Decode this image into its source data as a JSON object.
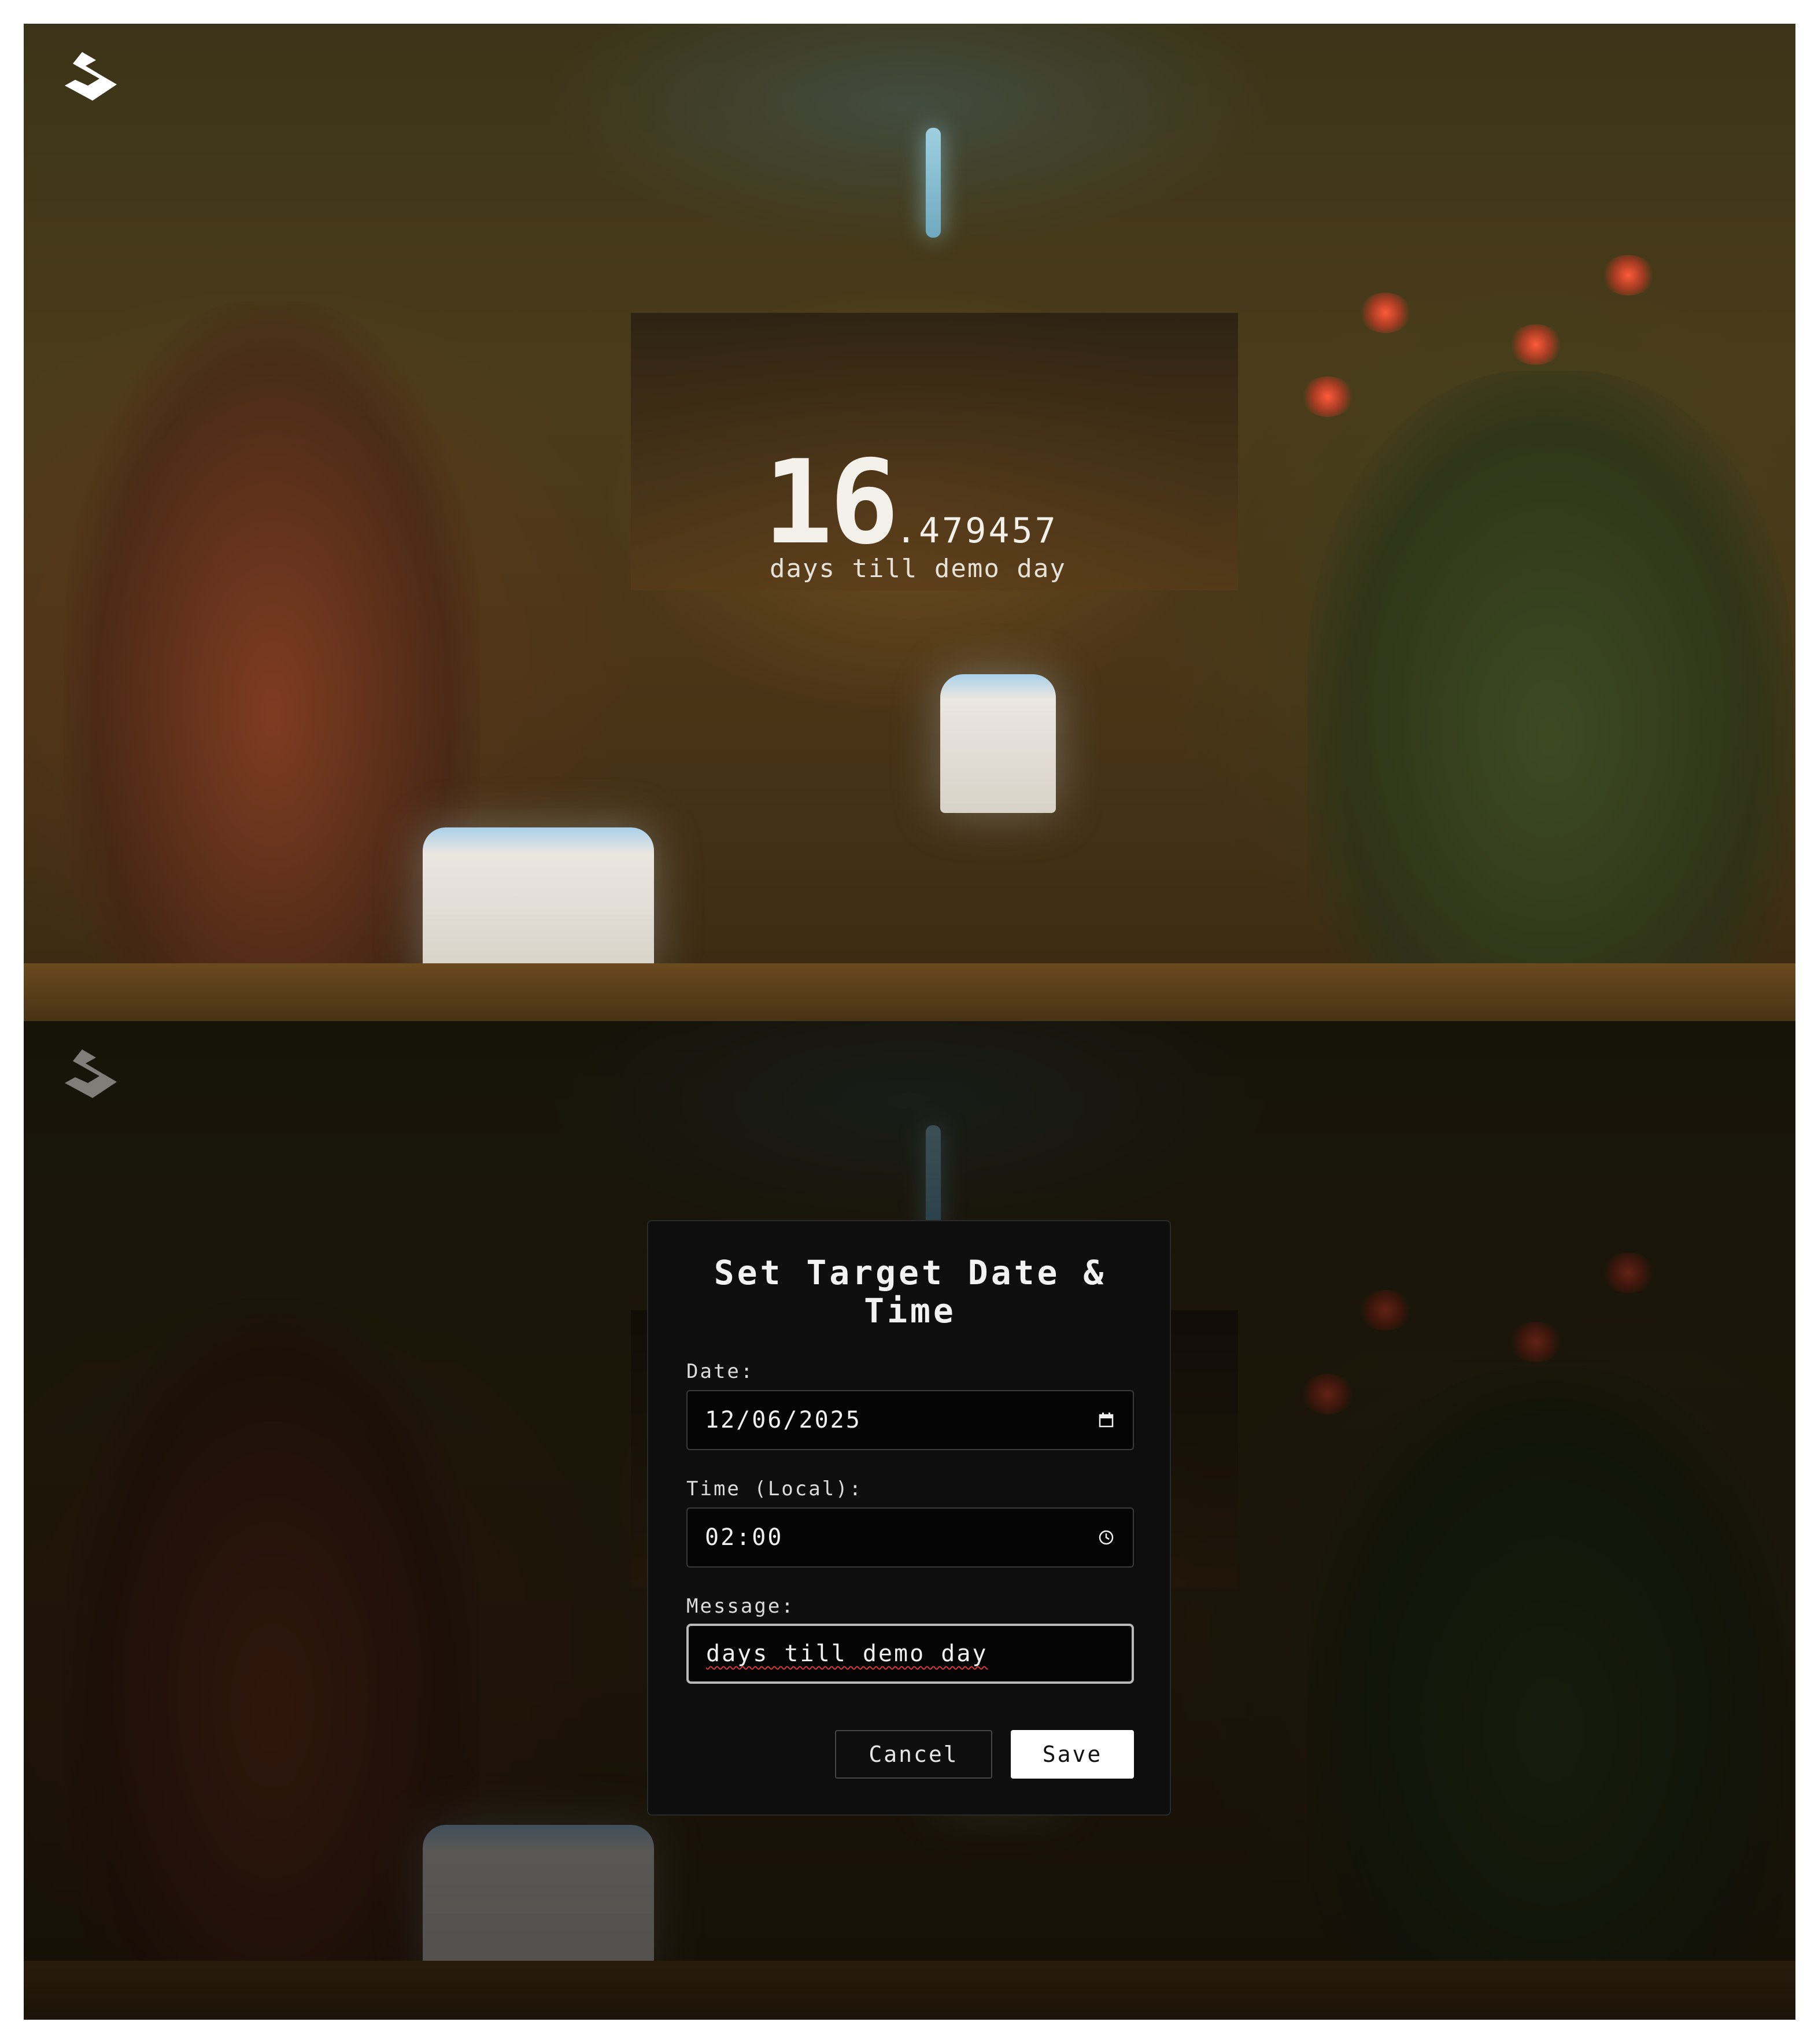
{
  "countdown": {
    "days_whole": "16",
    "days_fraction": ".479457",
    "message": "days till demo day"
  },
  "dialog": {
    "title": "Set Target Date & Time",
    "date_label": "Date:",
    "date_value": "12/06/2025",
    "time_label": "Time (Local):",
    "time_value": "02:00",
    "message_label": "Message:",
    "message_value": "days till demo day",
    "cancel_label": "Cancel",
    "save_label": "Save"
  },
  "icons": {
    "logo": "brand-logo-icon",
    "date": "calendar-icon",
    "time": "clock-icon"
  },
  "colors": {
    "modal_bg": "#0e0e0e",
    "save_bg": "#ffffff",
    "text": "#f2f2f2",
    "spellcheck": "#d23a3a"
  }
}
